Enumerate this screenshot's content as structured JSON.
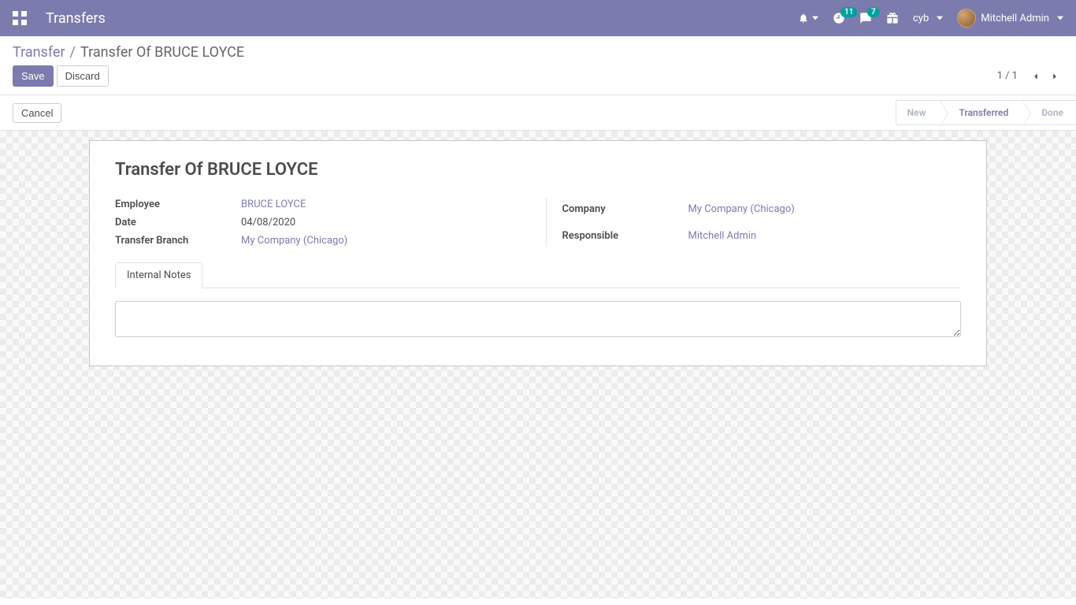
{
  "navbar": {
    "app_title": "Transfers",
    "activities_badge": "11",
    "messages_badge": "7",
    "company_short": "cyb",
    "user_name": "Mitchell Admin"
  },
  "breadcrumb": {
    "root": "Transfer",
    "current": "Transfer Of BRUCE LOYCE"
  },
  "buttons": {
    "save": "Save",
    "discard": "Discard",
    "cancel": "Cancel"
  },
  "pager": {
    "text": "1 / 1"
  },
  "status": {
    "new": "New",
    "transferred": "Transferred",
    "done": "Done"
  },
  "form": {
    "title": "Transfer Of BRUCE LOYCE",
    "labels": {
      "employee": "Employee",
      "date": "Date",
      "transfer_branch": "Transfer Branch",
      "company": "Company",
      "responsible": "Responsible"
    },
    "values": {
      "employee": "BRUCE LOYCE",
      "date": "04/08/2020",
      "transfer_branch": "My Company (Chicago)",
      "company": "My Company (Chicago)",
      "responsible": "Mitchell Admin"
    },
    "tabs": {
      "internal_notes": "Internal Notes"
    },
    "internal_notes_value": ""
  }
}
